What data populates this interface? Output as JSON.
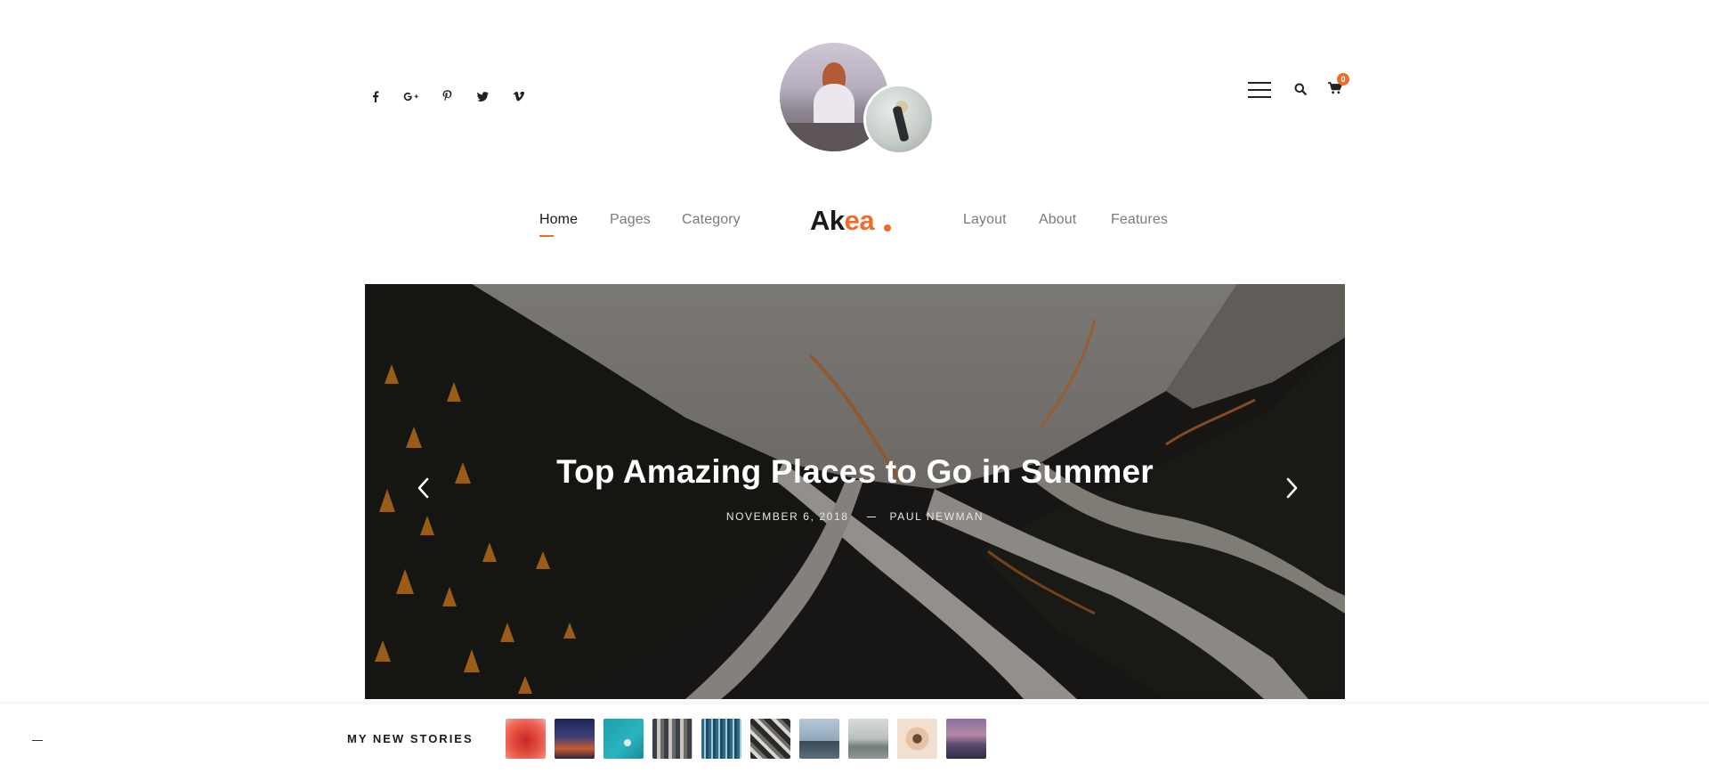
{
  "social": [
    {
      "name": "facebook-icon"
    },
    {
      "name": "google-plus-icon"
    },
    {
      "name": "pinterest-icon"
    },
    {
      "name": "twitter-icon"
    },
    {
      "name": "vimeo-icon"
    }
  ],
  "header": {
    "cart_count": "0"
  },
  "nav": {
    "left": [
      "Home",
      "Pages",
      "Category"
    ],
    "right": [
      "Layout",
      "About",
      "Features"
    ],
    "active": "Home"
  },
  "logo": {
    "ak": "Ak",
    "ea": "ea"
  },
  "hero": {
    "title": "Top Amazing Places to Go in Summer",
    "date": "NOVEMBER 6, 2018",
    "author": "PAUL NEWMAN"
  },
  "stories": {
    "label": "MY NEW STORIES",
    "thumbs": [
      {
        "name": "red-object"
      },
      {
        "name": "city-night"
      },
      {
        "name": "teal-objects"
      },
      {
        "name": "striped-building"
      },
      {
        "name": "blue-lines"
      },
      {
        "name": "rocky-texture"
      },
      {
        "name": "dock-lake"
      },
      {
        "name": "misty-lake"
      },
      {
        "name": "camera-person"
      },
      {
        "name": "purple-mountains"
      }
    ]
  },
  "colors": {
    "accent": "#f06c2a",
    "text": "#1a1a1a",
    "muted": "#7b7b7b"
  }
}
